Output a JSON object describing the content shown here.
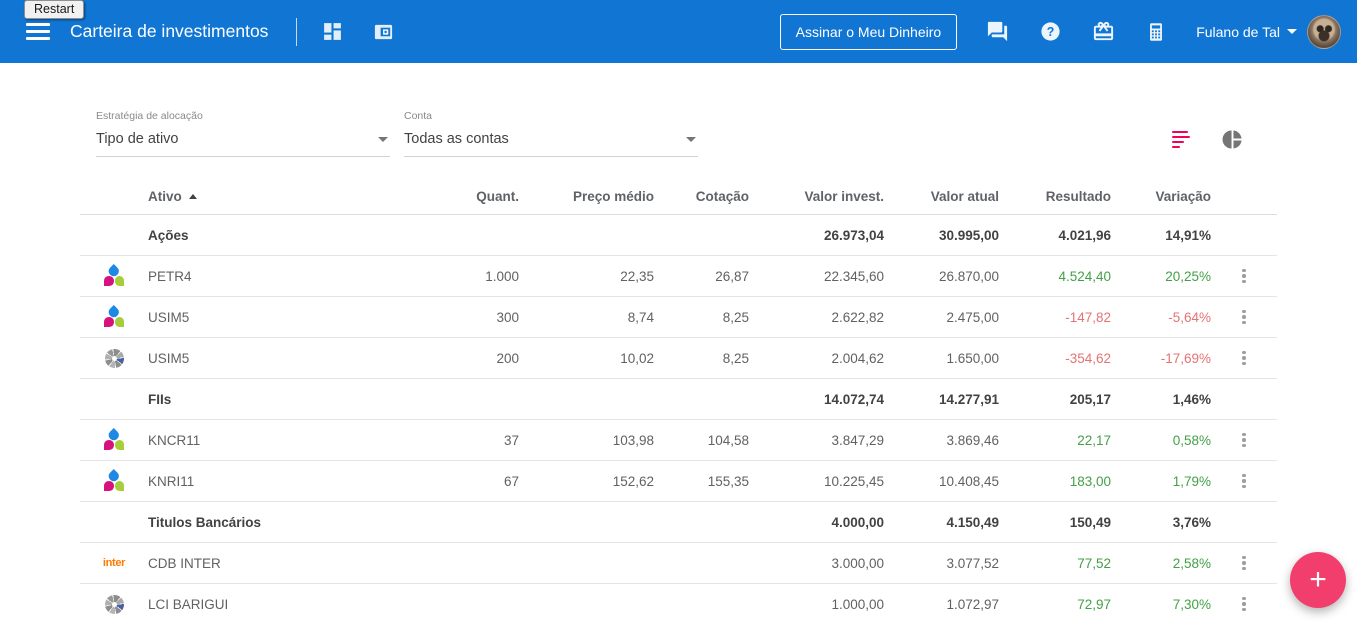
{
  "restart_label": "Restart",
  "header": {
    "title": "Carteira de investimentos",
    "subscribe_button": "Assinar o Meu Dinheiro",
    "user_name": "Fulano de Tal",
    "icons": [
      "menu-icon",
      "dashboard-icon",
      "wallet-icon",
      "chat-icon",
      "help-icon",
      "gift-icon",
      "calculator-icon",
      "caret-down-icon",
      "avatar"
    ]
  },
  "filters": {
    "strategy": {
      "label": "Estratégia de alocação",
      "value": "Tipo de ativo"
    },
    "account": {
      "label": "Conta",
      "value": "Todas as contas"
    }
  },
  "view_toggle": {
    "icons": [
      "list-view-icon",
      "pie-chart-view-icon"
    ],
    "active": "list-view"
  },
  "table": {
    "columns": [
      "Ativo",
      "Quant.",
      "Preço médio",
      "Cotação",
      "Valor invest.",
      "Valor atual",
      "Resultado",
      "Variação"
    ],
    "sort_column": "Ativo",
    "sort_direction": "asc",
    "rows": [
      {
        "type": "group",
        "name": "Ações",
        "quant": "",
        "preco_medio": "",
        "cotacao": "",
        "valor_invest": "26.973,04",
        "valor_atual": "30.995,00",
        "resultado": "4.021,96",
        "variacao": "14,91%",
        "trend": "up"
      },
      {
        "type": "asset",
        "icon": "rico",
        "name": "PETR4",
        "quant": "1.000",
        "preco_medio": "22,35",
        "cotacao": "26,87",
        "valor_invest": "22.345,60",
        "valor_atual": "26.870,00",
        "resultado": "4.524,40",
        "variacao": "20,25%",
        "trend": "up"
      },
      {
        "type": "asset",
        "icon": "rico",
        "name": "USIM5",
        "quant": "300",
        "preco_medio": "8,74",
        "cotacao": "8,25",
        "valor_invest": "2.622,82",
        "valor_atual": "2.475,00",
        "resultado": "-147,82",
        "variacao": "-5,64%",
        "trend": "down"
      },
      {
        "type": "asset",
        "icon": "shutter",
        "name": "USIM5",
        "quant": "200",
        "preco_medio": "10,02",
        "cotacao": "8,25",
        "valor_invest": "2.004,62",
        "valor_atual": "1.650,00",
        "resultado": "-354,62",
        "variacao": "-17,69%",
        "trend": "down"
      },
      {
        "type": "group",
        "name": "FIIs",
        "quant": "",
        "preco_medio": "",
        "cotacao": "",
        "valor_invest": "14.072,74",
        "valor_atual": "14.277,91",
        "resultado": "205,17",
        "variacao": "1,46%",
        "trend": "up"
      },
      {
        "type": "asset",
        "icon": "rico",
        "name": "KNCR11",
        "quant": "37",
        "preco_medio": "103,98",
        "cotacao": "104,58",
        "valor_invest": "3.847,29",
        "valor_atual": "3.869,46",
        "resultado": "22,17",
        "variacao": "0,58%",
        "trend": "up"
      },
      {
        "type": "asset",
        "icon": "rico",
        "name": "KNRI11",
        "quant": "67",
        "preco_medio": "152,62",
        "cotacao": "155,35",
        "valor_invest": "10.225,45",
        "valor_atual": "10.408,45",
        "resultado": "183,00",
        "variacao": "1,79%",
        "trend": "up"
      },
      {
        "type": "group",
        "name": "Titulos Bancários",
        "quant": "",
        "preco_medio": "",
        "cotacao": "",
        "valor_invest": "4.000,00",
        "valor_atual": "4.150,49",
        "resultado": "150,49",
        "variacao": "3,76%",
        "trend": "up"
      },
      {
        "type": "asset",
        "icon": "inter",
        "name": "CDB INTER",
        "quant": "",
        "preco_medio": "",
        "cotacao": "",
        "valor_invest": "3.000,00",
        "valor_atual": "3.077,52",
        "resultado": "77,52",
        "variacao": "2,58%",
        "trend": "up"
      },
      {
        "type": "asset",
        "icon": "shutter",
        "name": "LCI BARIGUI",
        "quant": "",
        "preco_medio": "",
        "cotacao": "",
        "valor_invest": "1.000,00",
        "valor_atual": "1.072,97",
        "resultado": "72,97",
        "variacao": "7,30%",
        "trend": "up"
      }
    ]
  },
  "fab": {
    "label": "+"
  },
  "colors": {
    "header_blue": "#1176D3",
    "positive_green": "#43A047",
    "negative_red": "#E57373",
    "accent_pink": "#F50057",
    "fab_pink": "#F13E6C",
    "inter_orange": "#FF7A00"
  }
}
